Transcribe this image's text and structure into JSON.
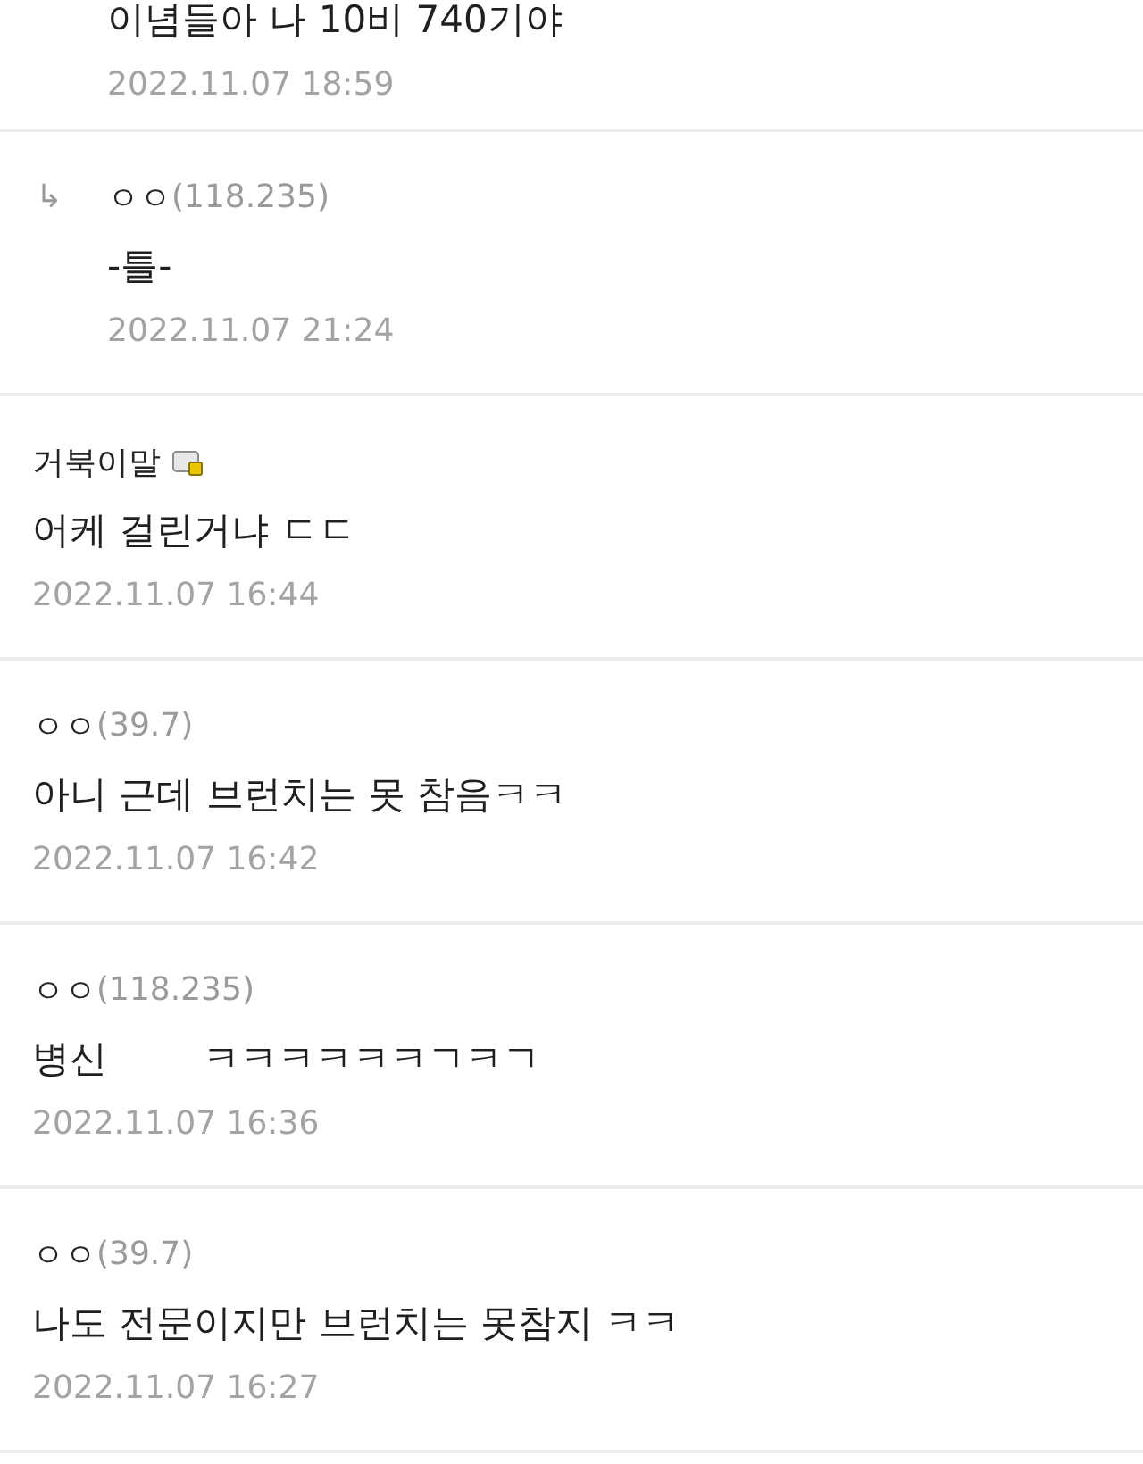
{
  "comments": [
    {
      "kind": "reply",
      "body": "이념들아 나 10비 740기야",
      "date": "2022.11.07 18:59"
    },
    {
      "kind": "reply",
      "reply_mark": "↳",
      "author": "ㅇㅇ",
      "ip": "(118.235)",
      "body": "-틀-",
      "date": "2022.11.07 21:24"
    },
    {
      "kind": "comment",
      "author": "거북이말",
      "member_badge": true,
      "body": "어케 걸린거냐 ㄷㄷ",
      "date": "2022.11.07 16:44"
    },
    {
      "kind": "comment",
      "author": "ㅇㅇ",
      "ip": "(39.7)",
      "member_badge": false,
      "body": "아니 근데 브런치는 못 참음ㅋㅋ",
      "date": "2022.11.07 16:42"
    },
    {
      "kind": "comment",
      "author": "ㅇㅇ",
      "ip": "(118.235)",
      "member_badge": false,
      "body": "병신        ㅋㅋㅋㅋㅋㅋㄱㅋㄱ",
      "date": "2022.11.07 16:36"
    },
    {
      "kind": "comment",
      "author": "ㅇㅇ",
      "ip": "(39.7)",
      "member_badge": false,
      "body": "나도 전문이지만 브런치는 못참지 ㅋㅋ",
      "date": "2022.11.07 16:27"
    }
  ]
}
